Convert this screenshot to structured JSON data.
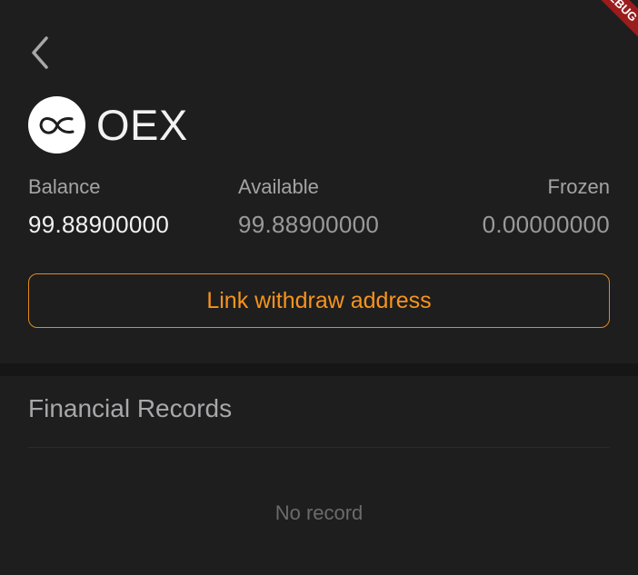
{
  "debug_banner": "DEBUG",
  "coin": {
    "name": "OEX",
    "logo_icon": "oex-infinity-logo"
  },
  "stats": {
    "balance": {
      "label": "Balance",
      "value": "99.88900000"
    },
    "available": {
      "label": "Available",
      "value": "99.88900000"
    },
    "frozen": {
      "label": "Frozen",
      "value": "0.00000000"
    }
  },
  "actions": {
    "link_withdraw_label": "Link withdraw address"
  },
  "records": {
    "title": "Financial Records",
    "empty_text": "No record"
  },
  "colors": {
    "background": "#1e1e1f",
    "accent": "#f7941d",
    "debug_ribbon": "#9b1c1c"
  }
}
